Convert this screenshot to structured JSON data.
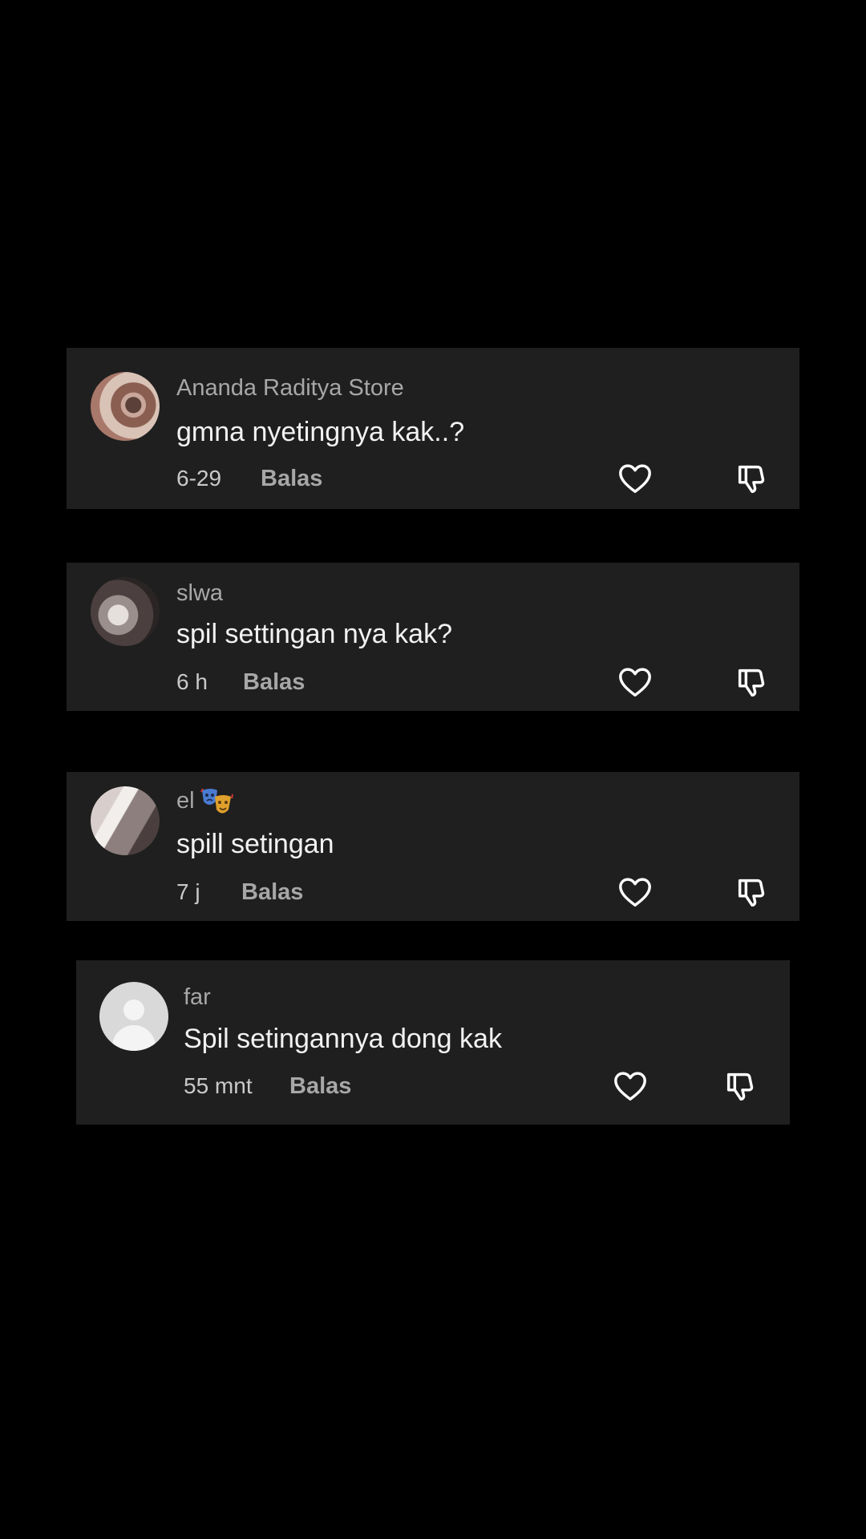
{
  "comments": [
    {
      "username": "Ananda Raditya Store",
      "text": "gmna nyetingnya kak..?",
      "time": "6-29",
      "reply_label": "Balas"
    },
    {
      "username": "slwa",
      "text": "spil settingan nya kak?",
      "time": "6 h",
      "reply_label": "Balas"
    },
    {
      "username": "el",
      "text": "spill setingan",
      "time": "7 j",
      "reply_label": "Balas"
    },
    {
      "username": "far",
      "text": "Spil setingannya dong kak",
      "time": "55 mnt",
      "reply_label": "Balas"
    }
  ],
  "colors": {
    "background": "#000000",
    "card": "#1f1f1f",
    "username": "#a7a7a7",
    "comment_text": "#f2f2f2"
  },
  "icons": {
    "like": "heart-outline-icon",
    "dislike": "thumbs-down-icon",
    "username_badge": "performing-arts-masks-icon"
  }
}
